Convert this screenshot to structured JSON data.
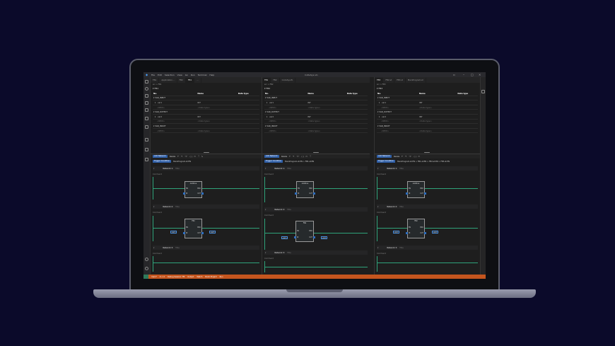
{
  "window": {
    "title": "CoDeSys sln",
    "menu": [
      "File",
      "Edit",
      "Selection",
      "View",
      "Go",
      "Run",
      "Terminal",
      "Help"
    ]
  },
  "panes": [
    {
      "tabs": [
        "FB1",
        "Application...",
        "FB2",
        "FB1",
        "..."
      ],
      "active_tab": 3,
      "breadcrumb": "src > FB1",
      "header": "FB1",
      "columns": [
        "No.",
        "Name",
        "Data type"
      ],
      "rows": [
        {
          "kind": "section",
          "label": "VAR_INPUT"
        },
        {
          "kind": "var",
          "no": "1",
          "name": "var1",
          "type": "INT"
        },
        {
          "kind": "add",
          "name": "<NEW>",
          "type": "<Data type>"
        },
        {
          "kind": "section",
          "label": "VAR_OUTPUT"
        },
        {
          "kind": "var",
          "no": "1",
          "name": "var2",
          "type": "INT"
        },
        {
          "kind": "add",
          "name": "<NEW>",
          "type": "<Data type>"
        },
        {
          "kind": "section",
          "label": "VAR_INOUT"
        },
        {
          "kind": "add",
          "name": "<NEW>",
          "type": "<Data type>"
        }
      ],
      "toolbar": {
        "add": "Add Network",
        "delete": "Delete"
      },
      "trigger": {
        "button": "Trigger Condition",
        "text": "MainProgram.st.EN"
      },
      "networks": [
        {
          "label": "Network 1:",
          "title": "Title",
          "comment": "Comment",
          "block": "AddOne"
        },
        {
          "label": "Network 2:",
          "title": "Title",
          "comment": "Comment",
          "block": "FB2"
        },
        {
          "label": "Network 3:",
          "title": "Title",
          "comment": "Comment"
        }
      ]
    },
    {
      "tabs": [
        "FB1",
        "FB2",
        "CodeSys.fb"
      ],
      "active_tab": 0,
      "breadcrumb": "src > FB2",
      "header": "FB2",
      "columns": [
        "No.",
        "Name",
        "Data type"
      ],
      "rows": [
        {
          "kind": "section",
          "label": "VAR_INPUT"
        },
        {
          "kind": "var",
          "no": "1",
          "name": "var1",
          "type": "INT"
        },
        {
          "kind": "add",
          "name": "<NEW>",
          "type": "<Data type>"
        },
        {
          "kind": "section",
          "label": "VAR_OUTPUT"
        },
        {
          "kind": "var",
          "no": "1",
          "name": "var2",
          "type": "INT"
        },
        {
          "kind": "add",
          "name": "<NEW>",
          "type": "<Data type>"
        },
        {
          "kind": "section",
          "label": "VAR_INOUT"
        },
        {
          "kind": "add",
          "name": "<NEW>",
          "type": "<Data type>"
        }
      ],
      "toolbar": {
        "add": "Add Network",
        "delete": "Delete"
      },
      "trigger": {
        "button": "Trigger Condition",
        "text": "MainProgram.st.EN > FB1.st.EN"
      },
      "networks": [
        {
          "label": "Network 1:",
          "title": "Title",
          "comment": "Comment",
          "block": "AddOne"
        },
        {
          "label": "Network 2:",
          "title": "Title",
          "comment": "Comment",
          "block": "FB2"
        },
        {
          "label": "Network 3:",
          "title": "Title",
          "comment": "Comment"
        }
      ]
    },
    {
      "tabs": [
        "FB3",
        "FB2.st",
        "FB3.st",
        "MainProgram.st"
      ],
      "active_tab": 0,
      "breadcrumb": "src > FB3",
      "header": "FB3",
      "columns": [
        "No.",
        "Name",
        "Data type"
      ],
      "rows": [
        {
          "kind": "section",
          "label": "VAR_INPUT"
        },
        {
          "kind": "var",
          "no": "1",
          "name": "var1",
          "type": "INT"
        },
        {
          "kind": "add",
          "name": "<NEW>",
          "type": "<Data type>"
        },
        {
          "kind": "section",
          "label": "VAR_OUTPUT"
        },
        {
          "kind": "var",
          "no": "1",
          "name": "var2",
          "type": "INT"
        },
        {
          "kind": "add",
          "name": "<NEW>",
          "type": "<Data type>"
        },
        {
          "kind": "section",
          "label": "VAR_INOUT"
        },
        {
          "kind": "add",
          "name": "<NEW>",
          "type": "<Data type>"
        }
      ],
      "toolbar": {
        "add": "Add Network",
        "delete": "Delete"
      },
      "trigger": {
        "button": "Trigger Condition",
        "text": "MainProgram.st.EN > FB1.st.EN > FB2.st.EN > FB3.st.EN"
      },
      "networks": [
        {
          "label": "Network 1:",
          "title": "Title",
          "comment": "Comment",
          "block": "AddOne"
        },
        {
          "label": "Network 2:",
          "title": "Title",
          "comment": "Comment",
          "block": "FB2"
        },
        {
          "label": "Network 3:",
          "title": "Title",
          "comment": "Comment"
        }
      ]
    }
  ],
  "block_pins": {
    "en": "EN",
    "eno": "ENO",
    "in": "IN",
    "out": "OUT",
    "in_var": "var1",
    "out_var": "var2"
  },
  "status": {
    "left": "main*",
    "items": [
      "0 ⚠ 0",
      "Debug Session: FB",
      "Output",
      "Watch",
      "Build Project",
      "Run"
    ]
  }
}
